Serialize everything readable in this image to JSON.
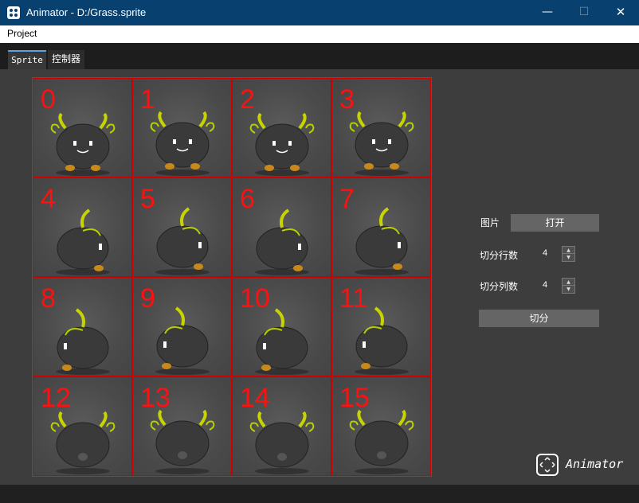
{
  "window": {
    "title": "Animator - D:/Grass.sprite",
    "minimize_glyph": "—",
    "maximize_glyph": "☐",
    "close_glyph": "✕"
  },
  "menu": {
    "items": [
      "Project"
    ]
  },
  "tabs": [
    "Sprite",
    "控制器"
  ],
  "grid": {
    "cells": [
      "0",
      "1",
      "2",
      "3",
      "4",
      "5",
      "6",
      "7",
      "8",
      "9",
      "10",
      "11",
      "12",
      "13",
      "14",
      "15"
    ],
    "border_color": "#d00000",
    "number_color": "#ff1010"
  },
  "panel": {
    "image_label": "图片",
    "open_button": "打开",
    "rows_label": "切分行数",
    "rows_value": "4",
    "cols_label": "切分列数",
    "cols_value": "4",
    "split_button": "切分"
  },
  "branding": {
    "logo_text": "Animator",
    "icon": "move-arrows-icon"
  },
  "colors": {
    "titlebar": "#08416f",
    "background": "#3d3d3d",
    "button": "#656565",
    "tab_accent": "#5aa2e0"
  }
}
